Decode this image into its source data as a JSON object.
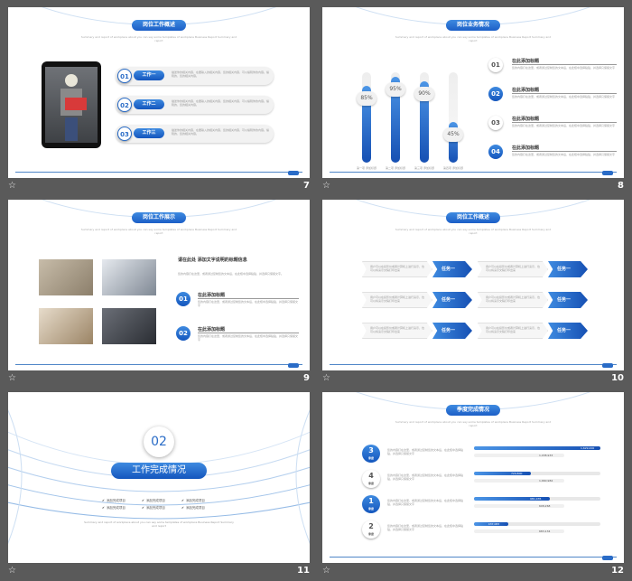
{
  "slides": [
    {
      "num": "7",
      "title": "岗位工作概述",
      "subtitle": "Summary and report of workplace about you can say some templates of workplace Business Report Summary and report",
      "items": [
        {
          "n": "01",
          "label": "工作一",
          "desc": "描述你的相关内容，在要输入的相关内容，您的相关内容，可以编辑你的内容。编辑的，您的相关内容。"
        },
        {
          "n": "02",
          "label": "工作二",
          "desc": "描述你的相关内容，在要输入的相关内容，您的相关内容，可以编辑你的内容。编辑的，您的相关内容。"
        },
        {
          "n": "03",
          "label": "工作三",
          "desc": "描述你的相关内容，在要输入的相关内容，您的相关内容，可以编辑你的内容。编辑的，您的相关内容。"
        }
      ]
    },
    {
      "num": "8",
      "title": "岗位业务情况",
      "subtitle": "Summary and report of workplace about you can say some templates of workplace Business Report Summary and report",
      "bars": [
        {
          "pct": "85%",
          "value": 0.85,
          "label": "第一项 添加标题"
        },
        {
          "pct": "95%",
          "value": 0.95,
          "label": "第二项 添加标题"
        },
        {
          "pct": "90%",
          "value": 0.9,
          "label": "第三项 添加标题"
        },
        {
          "pct": "45%",
          "value": 0.45,
          "label": "第四项 添加标题"
        }
      ],
      "points": [
        {
          "n": "01",
          "head": "在此添加标题",
          "desc": "您的内容打在这里，或者通过复制您的文本后，在此框中选择粘贴，并选择只保留文字"
        },
        {
          "n": "02",
          "head": "在此添加标题",
          "desc": "您的内容打在这里，或者通过复制您的文本后，在此框中选择粘贴，并选择只保留文字"
        },
        {
          "n": "03",
          "head": "在此添加标题",
          "desc": "您的内容打在这里，或者通过复制您的文本后，在此框中选择粘贴，并选择只保留文字"
        },
        {
          "n": "04",
          "head": "在此添加标题",
          "desc": "您的内容打在这里，或者通过复制您的文本后，在此框中选择粘贴，并选择只保留文字"
        }
      ]
    },
    {
      "num": "9",
      "title": "岗位工作展示",
      "subtitle": "Summary and report of workplace about you can say some templates of workplace Business Report Summary and report",
      "intro_title": "请在此处 添加文字说明的标题信息",
      "intro_desc": "您的内容打在这里，或者通过复制您的文本后，在此框中选择粘贴，并选择只保留文字。",
      "points": [
        {
          "n": "01",
          "head": "在此添加标题",
          "desc": "您的内容打在这里，或者通过复制您的文本后，在此框中选择粘贴，并选择只保留文字"
        },
        {
          "n": "02",
          "head": "在此添加标题",
          "desc": "您的内容打在这里，或者通过复制您的文本后，在此框中选择粘贴，并选择只保留文字"
        }
      ]
    },
    {
      "num": "10",
      "title": "岗位工作概述",
      "subtitle": "Summary and report of workplace about you can say some templates of workplace Business Report Summary and report",
      "task_label": "任务一",
      "task_desc": "用户可以在投影仪或者计算机上进行演示，也可以将演示文稿打印出来"
    },
    {
      "num": "11",
      "section_num": "02",
      "section_title": "工作完成情况",
      "bullets": [
        "添加完成项目",
        "添加完成项目",
        "添加完成项目",
        "添加完成项目",
        "添加完成项目",
        "添加完成项目"
      ],
      "desc": "Summary and report of workplace about you can say some templates of workplace Business Report Summary and report"
    },
    {
      "num": "12",
      "title": "季度完成情况",
      "subtitle": "Summary and report of workplace about you can say some templates of workplace Business Report Summary and report",
      "quarters": [
        {
          "n": "3",
          "q": "季度",
          "desc": "您的内容打在这里，或者通过复制您的文本后，在此框中选择粘贴，并选择只保留文字",
          "v1": "1,629,000",
          "f1": 1.0,
          "v2": "1,038,933",
          "f2": 0.0
        },
        {
          "n": "4",
          "q": "季度",
          "desc": "您的内容打在这里，或者通过复制您的文本后，在此框中选择粘贴，并选择只保留文字",
          "v1": "729,800",
          "f1": 0.45,
          "v2": "1,660,984",
          "f2": 0.0
        },
        {
          "n": "1",
          "q": "季度",
          "desc": "您的内容打在这里，或者通过复制您的文本后，在此框中选择粘贴，并选择只保留文字",
          "v1": "981,035",
          "f1": 0.6,
          "v2": "608,268",
          "f2": 0.0
        },
        {
          "n": "2",
          "q": "季度",
          "desc": "您的内容打在这里，或者通过复制您的文本后，在此框中选择粘贴，并选择只保留文字",
          "v1": "437,083",
          "f1": 0.27,
          "v2": "683,134",
          "f2": 0.0
        }
      ]
    }
  ]
}
